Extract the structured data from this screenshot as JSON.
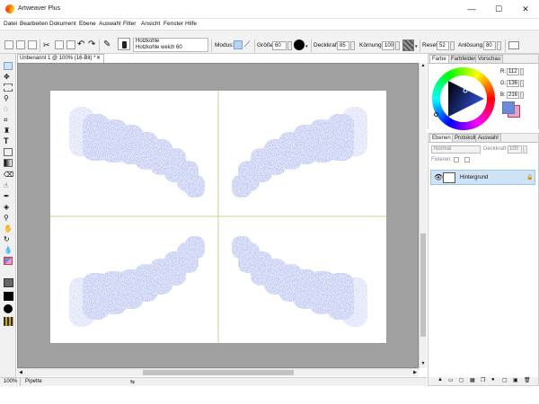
{
  "window": {
    "title": "Artweaver Plus",
    "minimize_glyph": "—",
    "maximize_glyph": "☐",
    "close_glyph": "✕"
  },
  "menu": [
    "Datei",
    "Bearbeiten",
    "Dokument",
    "Ebene",
    "Auswahl",
    "Filter",
    "Ansicht",
    "Fenster",
    "Hilfe"
  ],
  "options_bar": {
    "brush_category": "Holzkohle",
    "brush_variant": "Holzkohle weich 60",
    "mode_label": "Modus:",
    "size_label": "Größe:",
    "size_value": "60",
    "opacity_label": "Deckkraft:",
    "opacity_value": "85",
    "grain_label": "Körnung:",
    "grain_value": "100",
    "reset_label": "Reset:",
    "reset_value": "52",
    "dissolve_label": "Anlösung:",
    "dissolve_value": "80"
  },
  "document": {
    "tab_title": "Unbenannt 1 @ 100% (16-Bit) *",
    "close_glyph": "✕"
  },
  "status": {
    "zoom": "100%",
    "tool": "Pipette"
  },
  "color_panel": {
    "tabs": [
      "Farbe",
      "Farbfelder",
      "Vorschau"
    ],
    "active_tab": "Farbe",
    "r_label": "R:",
    "r_value": "112",
    "g_label": "G:",
    "g_value": "136",
    "b_label": "B:",
    "b_value": "216",
    "foreground_color": "#7088d8",
    "background_color": "#e8a0d0"
  },
  "layers_panel": {
    "tabs": [
      "Ebenen",
      "Protokoll",
      "Auswahl"
    ],
    "active_tab": "Ebenen",
    "blend_mode": "Normal",
    "opacity_label": "Deckkraft:",
    "opacity_value": "100",
    "lock_label": "Fixieren:",
    "layers": [
      {
        "name": "Hintergrund"
      }
    ]
  },
  "colors": {
    "accent": "#2f6fd6",
    "stroke": "#8e9fe8",
    "guide": "#c7d49a",
    "workspace": "#a0a0a0"
  }
}
